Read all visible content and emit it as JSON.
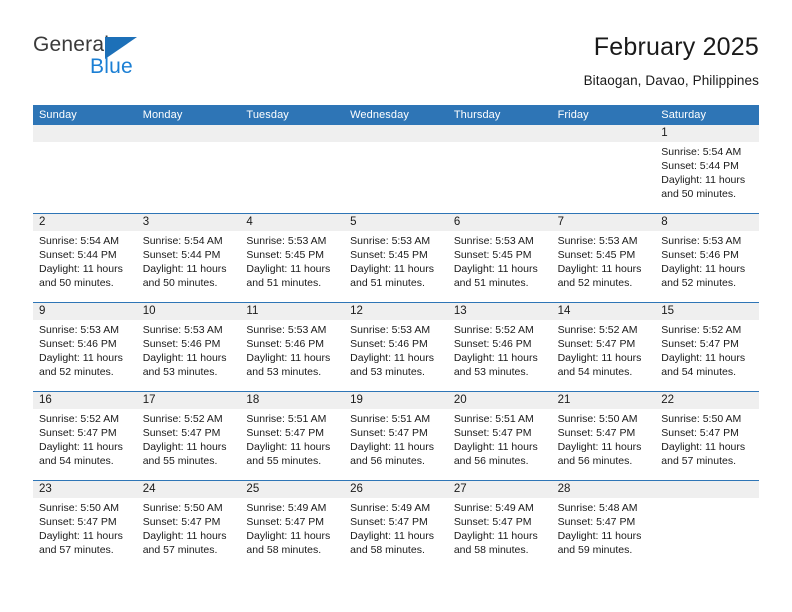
{
  "brand": {
    "name_part1": "General",
    "name_part2": "Blue",
    "logo_icon": "blue-triangle-flag-icon",
    "accent_color": "#1b7fd4"
  },
  "header": {
    "title": "February 2025",
    "location": "Bitaogan, Davao, Philippines"
  },
  "calendar": {
    "header_color": "#2e75b6",
    "daynum_band_color": "#efefef",
    "weekdays": [
      "Sunday",
      "Monday",
      "Tuesday",
      "Wednesday",
      "Thursday",
      "Friday",
      "Saturday"
    ],
    "weeks": [
      [
        {
          "num": "",
          "empty": true
        },
        {
          "num": "",
          "empty": true
        },
        {
          "num": "",
          "empty": true
        },
        {
          "num": "",
          "empty": true
        },
        {
          "num": "",
          "empty": true
        },
        {
          "num": "",
          "empty": true
        },
        {
          "num": "1",
          "sunrise": "Sunrise: 5:54 AM",
          "sunset": "Sunset: 5:44 PM",
          "daylight1": "Daylight: 11 hours",
          "daylight2": "and 50 minutes."
        }
      ],
      [
        {
          "num": "2",
          "sunrise": "Sunrise: 5:54 AM",
          "sunset": "Sunset: 5:44 PM",
          "daylight1": "Daylight: 11 hours",
          "daylight2": "and 50 minutes."
        },
        {
          "num": "3",
          "sunrise": "Sunrise: 5:54 AM",
          "sunset": "Sunset: 5:44 PM",
          "daylight1": "Daylight: 11 hours",
          "daylight2": "and 50 minutes."
        },
        {
          "num": "4",
          "sunrise": "Sunrise: 5:53 AM",
          "sunset": "Sunset: 5:45 PM",
          "daylight1": "Daylight: 11 hours",
          "daylight2": "and 51 minutes."
        },
        {
          "num": "5",
          "sunrise": "Sunrise: 5:53 AM",
          "sunset": "Sunset: 5:45 PM",
          "daylight1": "Daylight: 11 hours",
          "daylight2": "and 51 minutes."
        },
        {
          "num": "6",
          "sunrise": "Sunrise: 5:53 AM",
          "sunset": "Sunset: 5:45 PM",
          "daylight1": "Daylight: 11 hours",
          "daylight2": "and 51 minutes."
        },
        {
          "num": "7",
          "sunrise": "Sunrise: 5:53 AM",
          "sunset": "Sunset: 5:45 PM",
          "daylight1": "Daylight: 11 hours",
          "daylight2": "and 52 minutes."
        },
        {
          "num": "8",
          "sunrise": "Sunrise: 5:53 AM",
          "sunset": "Sunset: 5:46 PM",
          "daylight1": "Daylight: 11 hours",
          "daylight2": "and 52 minutes."
        }
      ],
      [
        {
          "num": "9",
          "sunrise": "Sunrise: 5:53 AM",
          "sunset": "Sunset: 5:46 PM",
          "daylight1": "Daylight: 11 hours",
          "daylight2": "and 52 minutes."
        },
        {
          "num": "10",
          "sunrise": "Sunrise: 5:53 AM",
          "sunset": "Sunset: 5:46 PM",
          "daylight1": "Daylight: 11 hours",
          "daylight2": "and 53 minutes."
        },
        {
          "num": "11",
          "sunrise": "Sunrise: 5:53 AM",
          "sunset": "Sunset: 5:46 PM",
          "daylight1": "Daylight: 11 hours",
          "daylight2": "and 53 minutes."
        },
        {
          "num": "12",
          "sunrise": "Sunrise: 5:53 AM",
          "sunset": "Sunset: 5:46 PM",
          "daylight1": "Daylight: 11 hours",
          "daylight2": "and 53 minutes."
        },
        {
          "num": "13",
          "sunrise": "Sunrise: 5:52 AM",
          "sunset": "Sunset: 5:46 PM",
          "daylight1": "Daylight: 11 hours",
          "daylight2": "and 53 minutes."
        },
        {
          "num": "14",
          "sunrise": "Sunrise: 5:52 AM",
          "sunset": "Sunset: 5:47 PM",
          "daylight1": "Daylight: 11 hours",
          "daylight2": "and 54 minutes."
        },
        {
          "num": "15",
          "sunrise": "Sunrise: 5:52 AM",
          "sunset": "Sunset: 5:47 PM",
          "daylight1": "Daylight: 11 hours",
          "daylight2": "and 54 minutes."
        }
      ],
      [
        {
          "num": "16",
          "sunrise": "Sunrise: 5:52 AM",
          "sunset": "Sunset: 5:47 PM",
          "daylight1": "Daylight: 11 hours",
          "daylight2": "and 54 minutes."
        },
        {
          "num": "17",
          "sunrise": "Sunrise: 5:52 AM",
          "sunset": "Sunset: 5:47 PM",
          "daylight1": "Daylight: 11 hours",
          "daylight2": "and 55 minutes."
        },
        {
          "num": "18",
          "sunrise": "Sunrise: 5:51 AM",
          "sunset": "Sunset: 5:47 PM",
          "daylight1": "Daylight: 11 hours",
          "daylight2": "and 55 minutes."
        },
        {
          "num": "19",
          "sunrise": "Sunrise: 5:51 AM",
          "sunset": "Sunset: 5:47 PM",
          "daylight1": "Daylight: 11 hours",
          "daylight2": "and 56 minutes."
        },
        {
          "num": "20",
          "sunrise": "Sunrise: 5:51 AM",
          "sunset": "Sunset: 5:47 PM",
          "daylight1": "Daylight: 11 hours",
          "daylight2": "and 56 minutes."
        },
        {
          "num": "21",
          "sunrise": "Sunrise: 5:50 AM",
          "sunset": "Sunset: 5:47 PM",
          "daylight1": "Daylight: 11 hours",
          "daylight2": "and 56 minutes."
        },
        {
          "num": "22",
          "sunrise": "Sunrise: 5:50 AM",
          "sunset": "Sunset: 5:47 PM",
          "daylight1": "Daylight: 11 hours",
          "daylight2": "and 57 minutes."
        }
      ],
      [
        {
          "num": "23",
          "sunrise": "Sunrise: 5:50 AM",
          "sunset": "Sunset: 5:47 PM",
          "daylight1": "Daylight: 11 hours",
          "daylight2": "and 57 minutes."
        },
        {
          "num": "24",
          "sunrise": "Sunrise: 5:50 AM",
          "sunset": "Sunset: 5:47 PM",
          "daylight1": "Daylight: 11 hours",
          "daylight2": "and 57 minutes."
        },
        {
          "num": "25",
          "sunrise": "Sunrise: 5:49 AM",
          "sunset": "Sunset: 5:47 PM",
          "daylight1": "Daylight: 11 hours",
          "daylight2": "and 58 minutes."
        },
        {
          "num": "26",
          "sunrise": "Sunrise: 5:49 AM",
          "sunset": "Sunset: 5:47 PM",
          "daylight1": "Daylight: 11 hours",
          "daylight2": "and 58 minutes."
        },
        {
          "num": "27",
          "sunrise": "Sunrise: 5:49 AM",
          "sunset": "Sunset: 5:47 PM",
          "daylight1": "Daylight: 11 hours",
          "daylight2": "and 58 minutes."
        },
        {
          "num": "28",
          "sunrise": "Sunrise: 5:48 AM",
          "sunset": "Sunset: 5:47 PM",
          "daylight1": "Daylight: 11 hours",
          "daylight2": "and 59 minutes."
        },
        {
          "num": "",
          "empty": true
        }
      ]
    ]
  }
}
